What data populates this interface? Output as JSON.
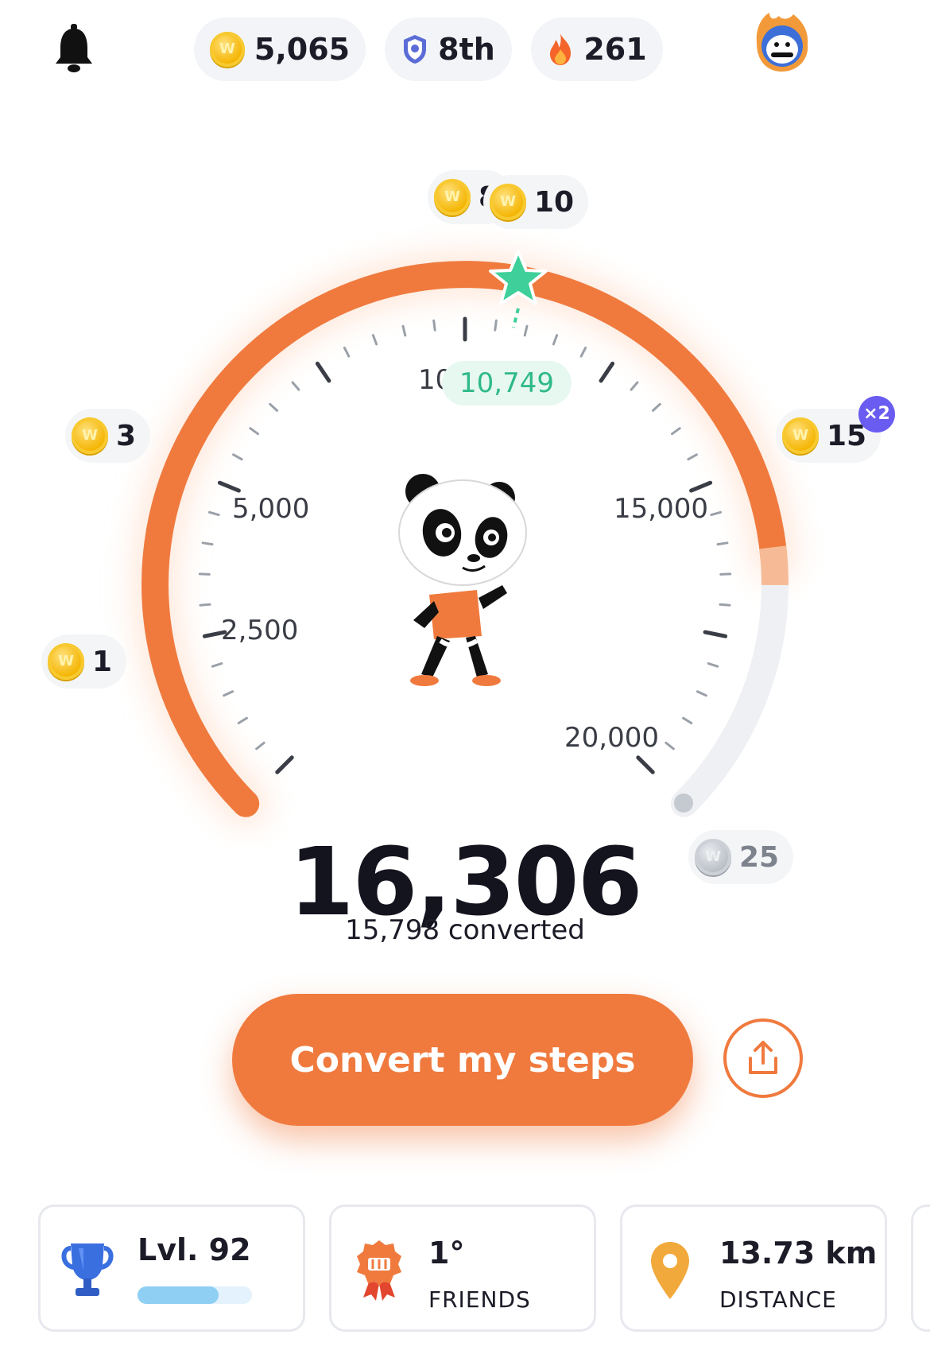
{
  "top_bar": {
    "coins": "5,065",
    "rank": "8th",
    "streak": "261"
  },
  "gauge": {
    "current_marker_value": "10,749",
    "partial_tick_label": "10",
    "tick_labels": [
      "2,500",
      "5,000",
      "15,000",
      "20,000"
    ],
    "progress_fraction": 0.8153,
    "colors": {
      "progress": "#f07a3e",
      "track": "#eef0f3",
      "star": "#3ecf9a"
    }
  },
  "rewards": [
    {
      "amount": "1"
    },
    {
      "amount": "3"
    },
    {
      "amount": "8"
    },
    {
      "amount": "10"
    },
    {
      "amount": "15",
      "multiplier": "×2"
    },
    {
      "amount": "25"
    }
  ],
  "coin_glyph": "W",
  "steps": {
    "value": "16,306",
    "converted": "15,798 converted"
  },
  "actions": {
    "convert_label": "Convert my steps"
  },
  "stats": {
    "level": {
      "value": "Lvl. 92",
      "progress": 0.71
    },
    "friends": {
      "value": "1°",
      "label": "FRIENDS"
    },
    "distance": {
      "value": "13.73 km",
      "label": "DISTANCE"
    }
  },
  "icons": [
    "bell-icon",
    "shield-rank-icon",
    "fire-icon",
    "coin-icon",
    "star-icon",
    "share-icon",
    "trophy-icon",
    "friends-badge-icon",
    "location-pin-icon"
  ]
}
